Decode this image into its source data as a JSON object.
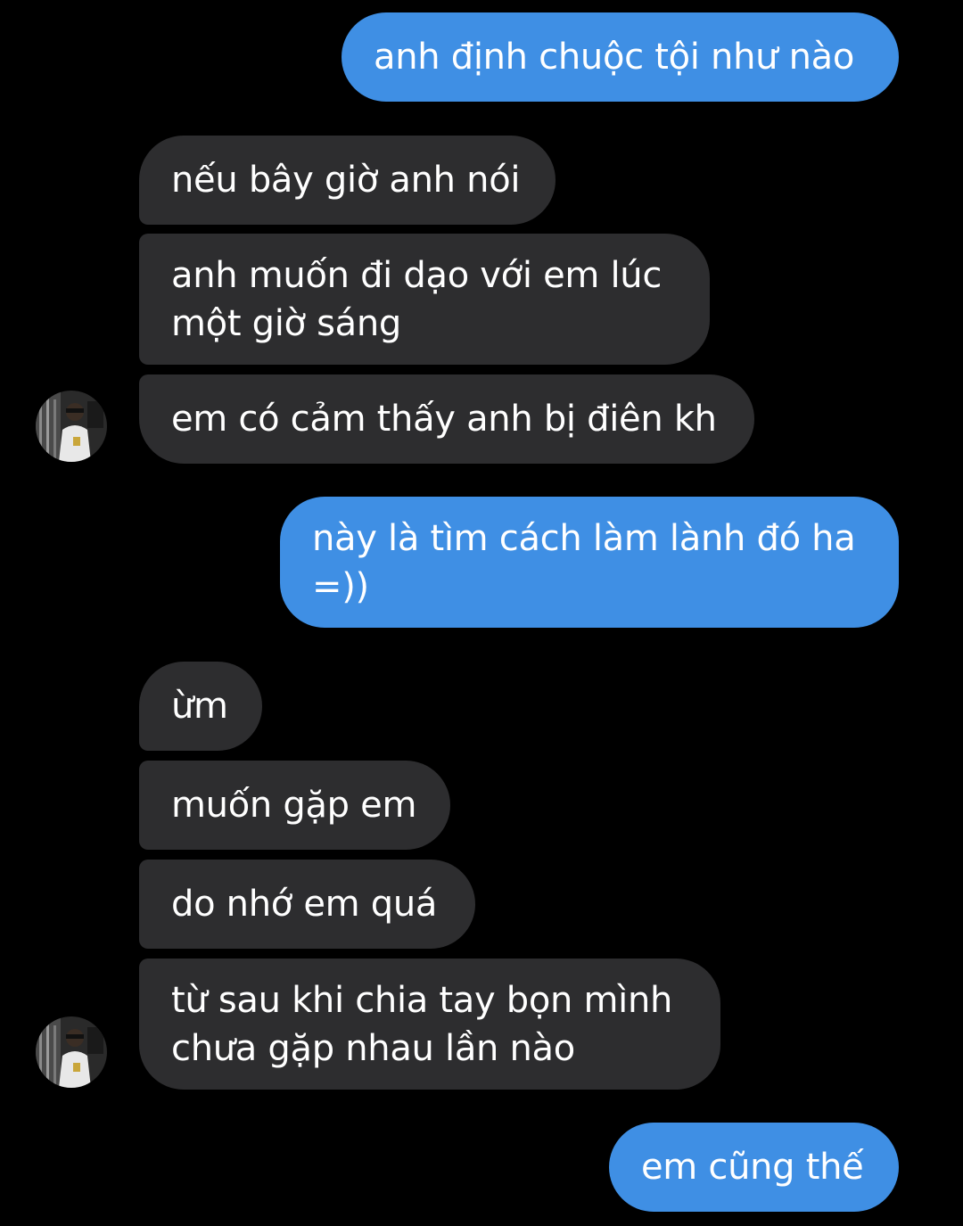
{
  "colors": {
    "background": "#000000",
    "sent_bubble": "#3F8FE4",
    "received_bubble": "#2D2D2F",
    "text": "#FFFFFF"
  },
  "messages": [
    {
      "direction": "sent",
      "text": "anh định chuộc tội như nào"
    },
    {
      "direction": "received",
      "text": "nếu bây giờ anh nói"
    },
    {
      "direction": "received",
      "text": "anh muốn đi dạo với em lúc một giờ sáng"
    },
    {
      "direction": "received",
      "text": "em có cảm thấy anh bị điên kh"
    },
    {
      "direction": "sent",
      "text": "này là tìm cách làm lành đó ha =))"
    },
    {
      "direction": "received",
      "text": "ừm"
    },
    {
      "direction": "received",
      "text": "muốn gặp em"
    },
    {
      "direction": "received",
      "text": "do nhớ em quá"
    },
    {
      "direction": "received",
      "text": "từ sau khi chia tay bọn mình chưa gặp nhau lần nào"
    },
    {
      "direction": "sent",
      "text": "em cũng thế"
    }
  ],
  "avatars": [
    {
      "icon": "contact-avatar-photo"
    },
    {
      "icon": "contact-avatar-photo"
    }
  ]
}
